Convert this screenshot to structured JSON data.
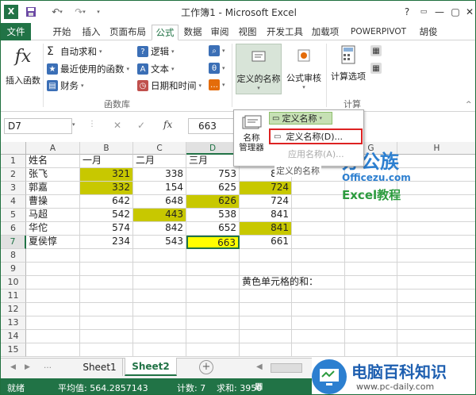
{
  "window": {
    "title": "工作簿1 - Microsoft Excel",
    "help": "?",
    "minimize": "—",
    "restore": "▢",
    "close": "✕"
  },
  "tabs": [
    {
      "label": "文件",
      "type": "file"
    },
    {
      "label": "开始"
    },
    {
      "label": "插入"
    },
    {
      "label": "页面布局"
    },
    {
      "label": "公式",
      "active": true
    },
    {
      "label": "数据"
    },
    {
      "label": "审阅"
    },
    {
      "label": "视图"
    },
    {
      "label": "开发工具"
    },
    {
      "label": "加载项"
    },
    {
      "label": "POWERPIVOT"
    }
  ],
  "user": {
    "name": "胡俊"
  },
  "ribbon": {
    "insert_function": {
      "glyph": "fx",
      "label": "插入函数"
    },
    "autosum": "自动求和",
    "recent": "最近使用的函数",
    "finance": "财务",
    "logic": "逻辑",
    "text": "文本",
    "datetime": "日期和时间",
    "group_library": "函数库",
    "defined_names": "定义的名称",
    "formula_audit": "公式审核",
    "calc_options": "计算选项",
    "group_calc": "计算"
  },
  "formula_bar": {
    "name_box": "D7",
    "cancel": "✕",
    "enter": "✓",
    "fx": "fx",
    "value": "663"
  },
  "dropdown": {
    "name_manager": "名称\n管理器",
    "define_name_btn": "定义名称",
    "define_name_item": "定义名称(D)...",
    "apply_name": "应用名称(A)...",
    "group_label": "定义的名称"
  },
  "grid": {
    "columns": [
      "A",
      "B",
      "C",
      "D",
      "E",
      "F",
      "G",
      "H"
    ],
    "rows": [
      "1",
      "2",
      "3",
      "4",
      "5",
      "6",
      "7",
      "8",
      "9",
      "10",
      "11",
      "12",
      "13",
      "14",
      "15"
    ],
    "cells": [
      {
        "r": 0,
        "c": 0,
        "v": "姓名"
      },
      {
        "r": 0,
        "c": 1,
        "v": "一月"
      },
      {
        "r": 0,
        "c": 2,
        "v": "二月"
      },
      {
        "r": 0,
        "c": 3,
        "v": "三月"
      },
      {
        "r": 1,
        "c": 0,
        "v": "张飞"
      },
      {
        "r": 1,
        "c": 1,
        "v": "321",
        "n": 1,
        "f": "olive"
      },
      {
        "r": 1,
        "c": 2,
        "v": "338",
        "n": 1
      },
      {
        "r": 1,
        "c": 3,
        "v": "753",
        "n": 1
      },
      {
        "r": 1,
        "c": 4,
        "v": "883",
        "n": 1
      },
      {
        "r": 2,
        "c": 0,
        "v": "郭嘉"
      },
      {
        "r": 2,
        "c": 1,
        "v": "332",
        "n": 1,
        "f": "olive"
      },
      {
        "r": 2,
        "c": 2,
        "v": "154",
        "n": 1
      },
      {
        "r": 2,
        "c": 3,
        "v": "625",
        "n": 1
      },
      {
        "r": 2,
        "c": 4,
        "v": "724",
        "n": 1,
        "f": "olive"
      },
      {
        "r": 3,
        "c": 0,
        "v": "曹操"
      },
      {
        "r": 3,
        "c": 1,
        "v": "642",
        "n": 1
      },
      {
        "r": 3,
        "c": 2,
        "v": "648",
        "n": 1
      },
      {
        "r": 3,
        "c": 3,
        "v": "626",
        "n": 1,
        "f": "olive"
      },
      {
        "r": 3,
        "c": 4,
        "v": "724",
        "n": 1
      },
      {
        "r": 4,
        "c": 0,
        "v": "马超"
      },
      {
        "r": 4,
        "c": 1,
        "v": "542",
        "n": 1
      },
      {
        "r": 4,
        "c": 2,
        "v": "443",
        "n": 1,
        "f": "olive"
      },
      {
        "r": 4,
        "c": 3,
        "v": "538",
        "n": 1
      },
      {
        "r": 4,
        "c": 4,
        "v": "841",
        "n": 1
      },
      {
        "r": 5,
        "c": 0,
        "v": "华佗"
      },
      {
        "r": 5,
        "c": 1,
        "v": "574",
        "n": 1
      },
      {
        "r": 5,
        "c": 2,
        "v": "842",
        "n": 1
      },
      {
        "r": 5,
        "c": 3,
        "v": "652",
        "n": 1
      },
      {
        "r": 5,
        "c": 4,
        "v": "841",
        "n": 1,
        "f": "olive"
      },
      {
        "r": 6,
        "c": 0,
        "v": "夏侯惇"
      },
      {
        "r": 6,
        "c": 1,
        "v": "234",
        "n": 1
      },
      {
        "r": 6,
        "c": 2,
        "v": "543",
        "n": 1
      },
      {
        "r": 6,
        "c": 3,
        "v": "663",
        "n": 1,
        "f": "yellow"
      },
      {
        "r": 6,
        "c": 4,
        "v": "661",
        "n": 1
      },
      {
        "r": 9,
        "c": 4,
        "v": "黄色单元格的和："
      }
    ]
  },
  "watermark": {
    "brand1": "办公族",
    "site1": "Officezu.com",
    "sub1": "Excel教程",
    "brand2": "电脑百科知识",
    "site2": "www.pc-daily.com"
  },
  "sheets": [
    {
      "label": "Sheet1"
    },
    {
      "label": "Sheet2",
      "active": true
    }
  ],
  "add_sheet": "+",
  "status": {
    "ready": "就绪",
    "avg": "平均值: 564.2857143",
    "count": "计数: 7",
    "sum": "求和: 3950"
  },
  "colors": {
    "excel_green": "#217346",
    "olive": "#c8c800",
    "yellow": "#ffff00"
  }
}
